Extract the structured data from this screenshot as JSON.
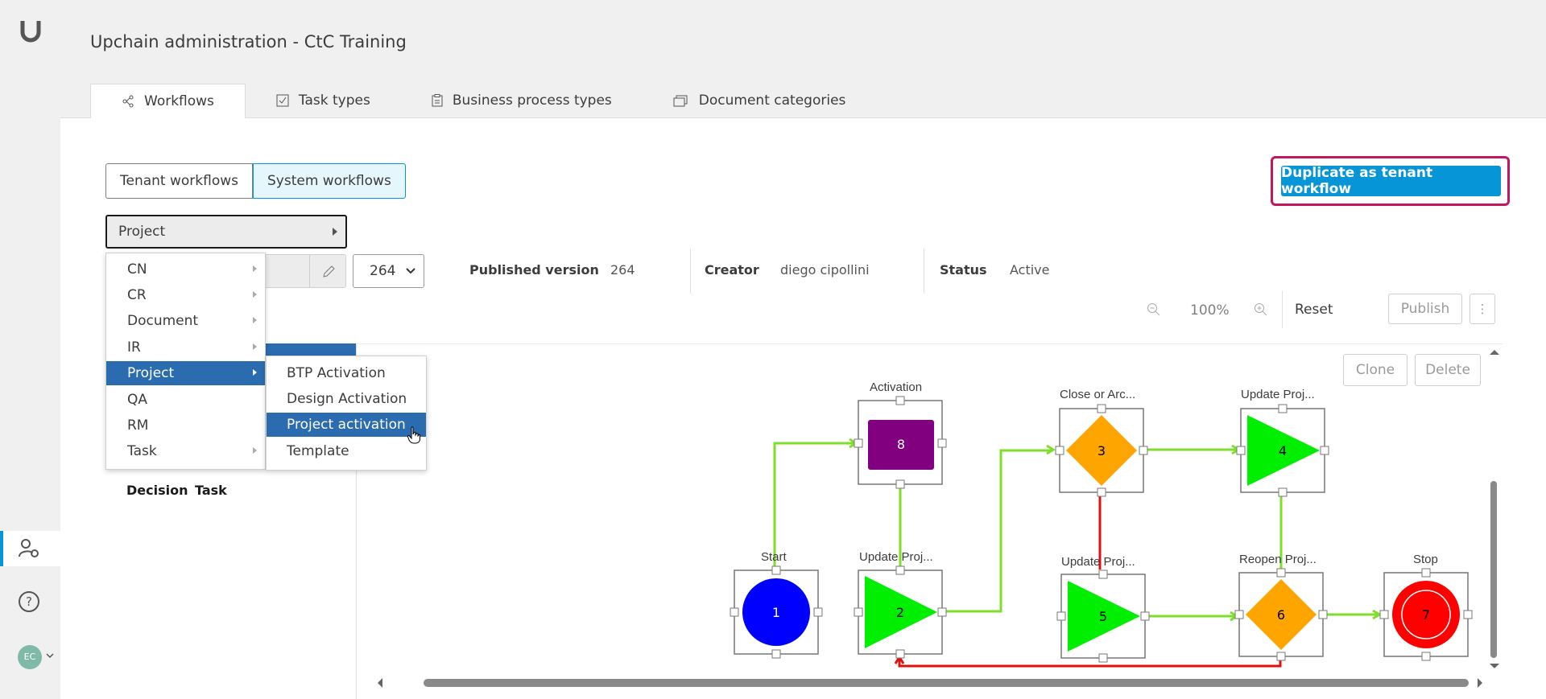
{
  "app_title": "Upchain administration - CtC Training",
  "tabs": [
    {
      "label": "Workflows",
      "icon": "workflow-icon"
    },
    {
      "label": "Task types",
      "icon": "checkbox-icon"
    },
    {
      "label": "Business process types",
      "icon": "clipboard-icon"
    },
    {
      "label": "Document categories",
      "icon": "documents-icon"
    }
  ],
  "toggle": {
    "tenant": "Tenant workflows",
    "system": "System workflows"
  },
  "duplicate_button": "Duplicate as tenant workflow",
  "category_select": "Project",
  "version": "264",
  "meta": {
    "published_label": "Published version",
    "published_value": "264",
    "creator_label": "Creator",
    "creator_value": "diego cipollini",
    "status_label": "Status",
    "status_value": "Active"
  },
  "toolbar": {
    "zoom": "100%",
    "reset": "Reset",
    "publish": "Publish",
    "more": "⋮"
  },
  "menu": {
    "items": [
      "CN",
      "CR",
      "Document",
      "IR",
      "Project",
      "QA",
      "RM",
      "Task"
    ],
    "selected": "Project",
    "submenu": [
      "BTP Activation",
      "Design Activation",
      "Project activation",
      "Template"
    ],
    "submenu_selected": "Project activation"
  },
  "palette": {
    "decision": "Decision",
    "task": "Task"
  },
  "canvas_buttons": {
    "clone": "Clone",
    "delete": "Delete"
  },
  "nodes": [
    {
      "id": "1",
      "label": "Start",
      "shape": "circle",
      "color": "#0000ff"
    },
    {
      "id": "2",
      "label": "Update Proj...",
      "shape": "triangle",
      "color": "#00ee00"
    },
    {
      "id": "3",
      "label": "Close or Arc...",
      "shape": "diamond",
      "color": "#ffa500"
    },
    {
      "id": "4",
      "label": "Update Proj...",
      "shape": "triangle",
      "color": "#00ee00"
    },
    {
      "id": "5",
      "label": "Update Proj...",
      "shape": "triangle",
      "color": "#00ee00"
    },
    {
      "id": "6",
      "label": "Reopen Proj...",
      "shape": "diamond",
      "color": "#ffa500"
    },
    {
      "id": "7",
      "label": "Stop",
      "shape": "stop-circle",
      "color": "#ff0000"
    },
    {
      "id": "8",
      "label": "Activation",
      "shape": "rect",
      "color": "#800080"
    }
  ],
  "colors": {
    "accent": "#0696d7",
    "highlight": "#c2185b",
    "edge_ok": "#7ddf2a",
    "edge_reject": "#e01010",
    "menu_selected": "#2b6cb0"
  },
  "user_initials": "EC"
}
